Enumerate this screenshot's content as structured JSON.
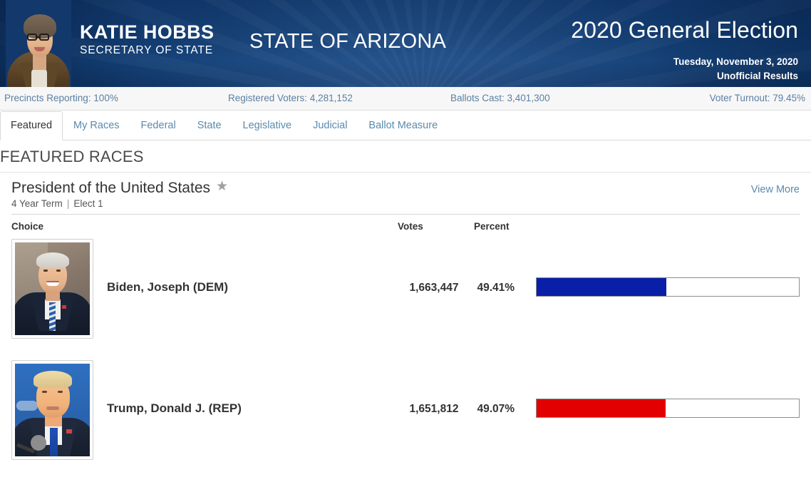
{
  "header": {
    "portrait_alt": "Katie Hobbs portrait",
    "brand_name": "KATIE HOBBS",
    "brand_subtitle": "SECRETARY OF STATE",
    "state_title": "STATE OF ARIZONA",
    "election_title": "2020 General Election",
    "election_date": "Tuesday, November 3, 2020",
    "election_status": "Unofficial Results",
    "bg_color": "#0e3669"
  },
  "stats": [
    {
      "label": "Precincts Reporting",
      "value": "100%",
      "text": "Precincts Reporting: 100%"
    },
    {
      "label": "Registered Voters",
      "value": "4,281,152",
      "text": "Registered Voters: 4,281,152"
    },
    {
      "label": "Ballots Cast",
      "value": "3,401,300",
      "text": "Ballots Cast: 3,401,300"
    },
    {
      "label": "Voter Turnout",
      "value": "79.45%",
      "text": "Voter Turnout: 79.45%"
    }
  ],
  "tabs": [
    {
      "label": "Featured",
      "active": true
    },
    {
      "label": "My Races",
      "active": false
    },
    {
      "label": "Federal",
      "active": false
    },
    {
      "label": "State",
      "active": false
    },
    {
      "label": "Legislative",
      "active": false
    },
    {
      "label": "Judicial",
      "active": false
    },
    {
      "label": "Ballot Measure",
      "active": false
    }
  ],
  "section": {
    "title": "FEATURED RACES"
  },
  "race": {
    "title": "President of the United States",
    "starred": true,
    "term": "4 Year Term",
    "separator": "|",
    "elect": "Elect 1",
    "view_more": "View More",
    "columns": {
      "choice": "Choice",
      "votes": "Votes",
      "percent": "Percent"
    }
  },
  "chart_data": {
    "type": "bar",
    "title": "President of the United States",
    "categories": [
      "Biden, Joseph (DEM)",
      "Trump, Donald J. (REP)"
    ],
    "values": [
      49.41,
      49.07
    ],
    "votes": [
      1663447,
      1651812
    ],
    "xlabel": "",
    "ylabel": "Percent",
    "ylim": [
      0,
      100
    ]
  },
  "candidates": [
    {
      "name": "Biden, Joseph (DEM)",
      "votes": "1,663,447",
      "percent": "49.41%",
      "percent_value": 49.41,
      "bar_color": "#0a1fa8",
      "photo": "biden-photo"
    },
    {
      "name": "Trump, Donald J. (REP)",
      "votes": "1,651,812",
      "percent": "49.07%",
      "percent_value": 49.07,
      "bar_color": "#e20000",
      "photo": "trump-photo"
    }
  ],
  "icons": {
    "star": "★"
  }
}
